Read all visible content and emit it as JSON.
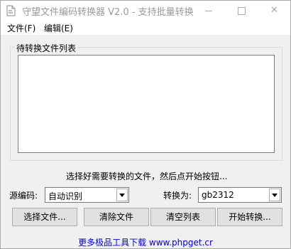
{
  "window": {
    "title": "守望文件编码转换器 V2.0 - 支持批量转换"
  },
  "menu": {
    "items": [
      {
        "label": "文件(F)"
      },
      {
        "label": "编辑(E)"
      }
    ]
  },
  "file_list": {
    "group_label": "待转换文件列表"
  },
  "hint": "选择好需要转换的文件，然后点开始按钮...",
  "source_encoding": {
    "label": "源编码:",
    "value": "自动识别"
  },
  "target_encoding": {
    "label": "转换为:",
    "value": "gb2312"
  },
  "buttons": {
    "select_files": "选择文件...",
    "remove_file": "清除文件",
    "clear_list": "清空列表",
    "start_convert": "开始转换..."
  },
  "footer": {
    "link_text": "更多极品工具下载 www.phpget.cr"
  },
  "icons": {
    "app": "app-icon",
    "minimize": "minimize-icon",
    "maximize": "maximize-icon",
    "close": "close-icon",
    "dropdown": "chevron-down-icon"
  },
  "colors": {
    "window_bg": "#f0f0f0",
    "title_text": "#999999",
    "link": "#0000cc"
  }
}
